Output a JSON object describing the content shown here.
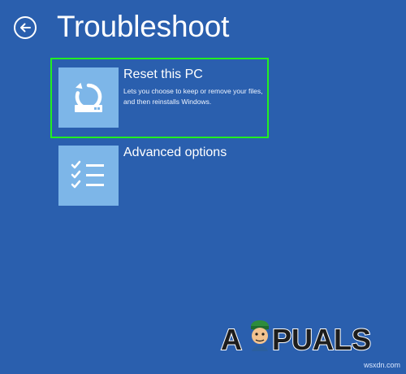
{
  "page": {
    "title": "Troubleshoot"
  },
  "options": [
    {
      "title": "Reset this PC",
      "description": "Lets you choose to keep or remove your files, and then reinstalls Windows.",
      "icon": "reset-pc-icon",
      "selected": true
    },
    {
      "title": "Advanced options",
      "description": "",
      "icon": "checklist-icon",
      "selected": false
    }
  ],
  "watermark": {
    "brand": "APPUALS",
    "site": "wsxdn.com"
  },
  "colors": {
    "background": "#2a5fae",
    "tile": "#7db6e8",
    "selection_outline": "#22ee22",
    "text": "#ffffff"
  }
}
